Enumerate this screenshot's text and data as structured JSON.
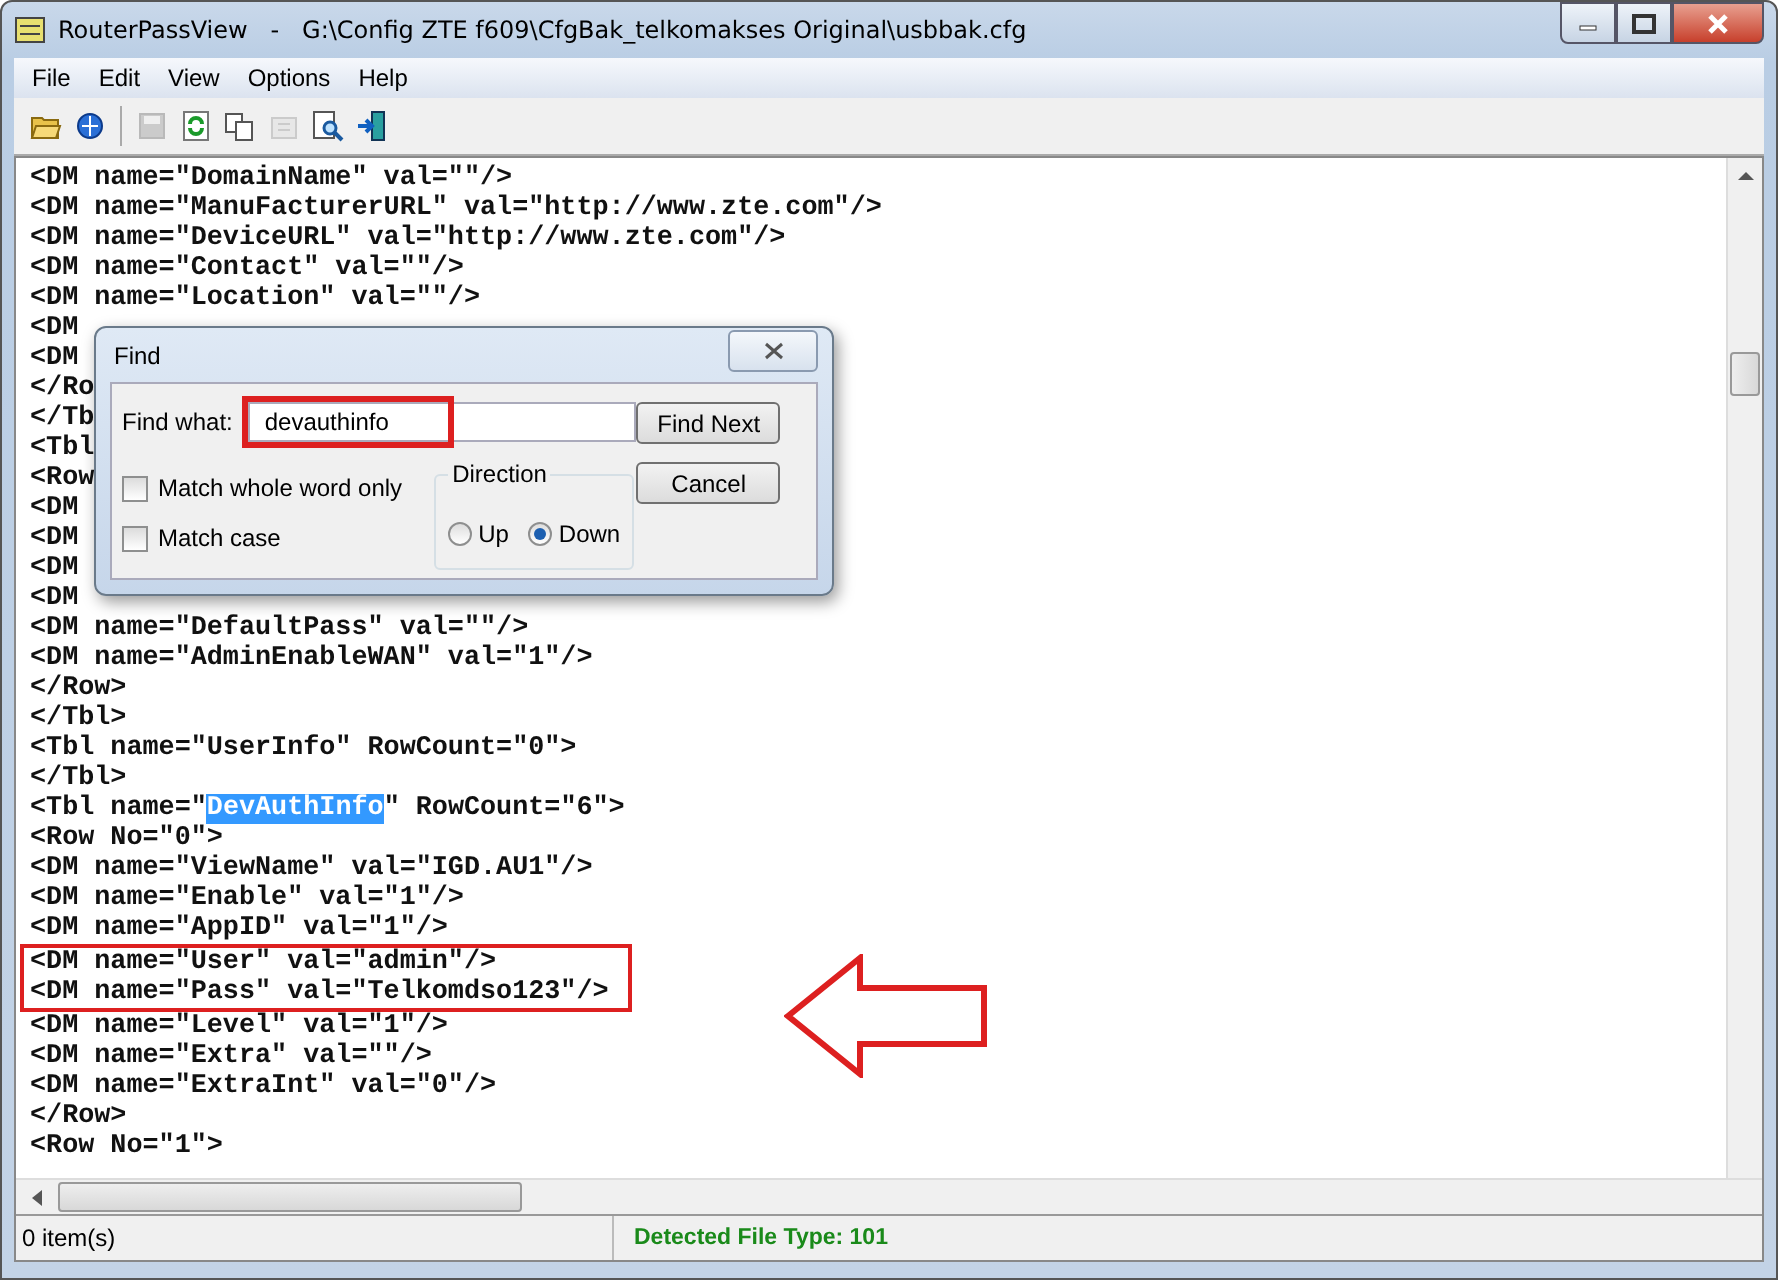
{
  "window": {
    "title": "RouterPassView   -   G:\\Config ZTE f609\\CfgBak_telkomakses Original\\usbbak.cfg"
  },
  "menu": [
    "File",
    "Edit",
    "View",
    "Options",
    "Help"
  ],
  "toolbar": [
    {
      "kind": "open",
      "disabled": false
    },
    {
      "kind": "browser",
      "disabled": false
    },
    {
      "kind": "separator",
      "disabled": false
    },
    {
      "kind": "save",
      "disabled": true
    },
    {
      "kind": "refresh",
      "disabled": false
    },
    {
      "kind": "copy",
      "disabled": false
    },
    {
      "kind": "properties",
      "disabled": true
    },
    {
      "kind": "find",
      "disabled": false
    },
    {
      "kind": "exit",
      "disabled": false
    }
  ],
  "editor": {
    "lines": [
      {
        "parts": [
          {
            "text": "<DM name=\"DomainName\" val=\"\"/>",
            "selected": false
          }
        ]
      },
      {
        "parts": [
          {
            "text": "<DM name=\"ManuFacturerURL\" val=\"http://www.zte.com\"/>",
            "selected": false
          }
        ]
      },
      {
        "parts": [
          {
            "text": "<DM name=\"DeviceURL\" val=\"http://www.zte.com\"/>",
            "selected": false
          }
        ]
      },
      {
        "parts": [
          {
            "text": "<DM name=\"Contact\" val=\"\"/>",
            "selected": false
          }
        ]
      },
      {
        "parts": [
          {
            "text": "<DM name=\"Location\" val=\"\"/>",
            "selected": false
          }
        ]
      },
      {
        "parts": [
          {
            "text": "<DM",
            "selected": false
          }
        ]
      },
      {
        "parts": [
          {
            "text": "<DM",
            "selected": false
          }
        ]
      },
      {
        "parts": [
          {
            "text": "</Ro",
            "selected": false
          }
        ]
      },
      {
        "parts": [
          {
            "text": "</Tb",
            "selected": false
          }
        ]
      },
      {
        "parts": [
          {
            "text": "<Tbl",
            "selected": false
          }
        ]
      },
      {
        "parts": [
          {
            "text": "<Row",
            "selected": false
          }
        ]
      },
      {
        "parts": [
          {
            "text": "<DM",
            "selected": false
          }
        ]
      },
      {
        "parts": [
          {
            "text": "<DM",
            "selected": false
          }
        ]
      },
      {
        "parts": [
          {
            "text": "<DM",
            "selected": false
          }
        ]
      },
      {
        "parts": [
          {
            "text": "<DM",
            "selected": false
          }
        ]
      },
      {
        "parts": [
          {
            "text": "<DM name=\"DefaultPass\" val=\"\"/>",
            "selected": false
          }
        ]
      },
      {
        "parts": [
          {
            "text": "<DM name=\"AdminEnableWAN\" val=\"1\"/>",
            "selected": false
          }
        ]
      },
      {
        "parts": [
          {
            "text": "</Row>",
            "selected": false
          }
        ]
      },
      {
        "parts": [
          {
            "text": "</Tbl>",
            "selected": false
          }
        ]
      },
      {
        "parts": [
          {
            "text": "<Tbl name=\"UserInfo\" RowCount=\"0\">",
            "selected": false
          }
        ]
      },
      {
        "parts": [
          {
            "text": "</Tbl>",
            "selected": false
          }
        ]
      },
      {
        "parts": [
          {
            "text": "<Tbl name=\"",
            "selected": false
          },
          {
            "text": "DevAuthInfo",
            "selected": true
          },
          {
            "text": "\" RowCount=\"6\">",
            "selected": false
          }
        ]
      },
      {
        "parts": [
          {
            "text": "<Row No=\"0\">",
            "selected": false
          }
        ]
      },
      {
        "parts": [
          {
            "text": "<DM name=\"ViewName\" val=\"IGD.AU1\"/>",
            "selected": false
          }
        ]
      },
      {
        "parts": [
          {
            "text": "<DM name=\"Enable\" val=\"1\"/>",
            "selected": false
          }
        ]
      },
      {
        "parts": [
          {
            "text": "<DM name=\"AppID\" val=\"1\"/>",
            "selected": false
          }
        ]
      },
      {
        "parts": [
          {
            "text": "<DM name=\"User\" val=\"admin\"/>",
            "selected": false
          }
        ]
      },
      {
        "parts": [
          {
            "text": "<DM name=\"Pass\" val=\"Telkomdso123\"/>",
            "selected": false
          }
        ]
      },
      {
        "parts": [
          {
            "text": "<DM name=\"Level\" val=\"1\"/>",
            "selected": false
          }
        ]
      },
      {
        "parts": [
          {
            "text": "<DM name=\"Extra\" val=\"\"/>",
            "selected": false
          }
        ]
      },
      {
        "parts": [
          {
            "text": "<DM name=\"ExtraInt\" val=\"0\"/>",
            "selected": false
          }
        ]
      },
      {
        "parts": [
          {
            "text": "</Row>",
            "selected": false
          }
        ]
      },
      {
        "parts": [
          {
            "text": "<Row No=\"1\">",
            "selected": false
          }
        ]
      }
    ]
  },
  "find_dialog": {
    "title": "Find",
    "find_what_label": "Find what:",
    "find_what_value": "devauthinfo",
    "options": [
      {
        "label": "Match whole word only",
        "checked": false
      },
      {
        "label": "Match case",
        "checked": false
      }
    ],
    "direction": {
      "label": "Direction",
      "options": [
        {
          "label": "Up",
          "selected": false
        },
        {
          "label": "Down",
          "selected": true
        }
      ]
    },
    "buttons": [
      "Find Next",
      "Cancel"
    ]
  },
  "status_bar": {
    "items": "0 item(s)",
    "file_type": "Detected File Type: 101"
  }
}
